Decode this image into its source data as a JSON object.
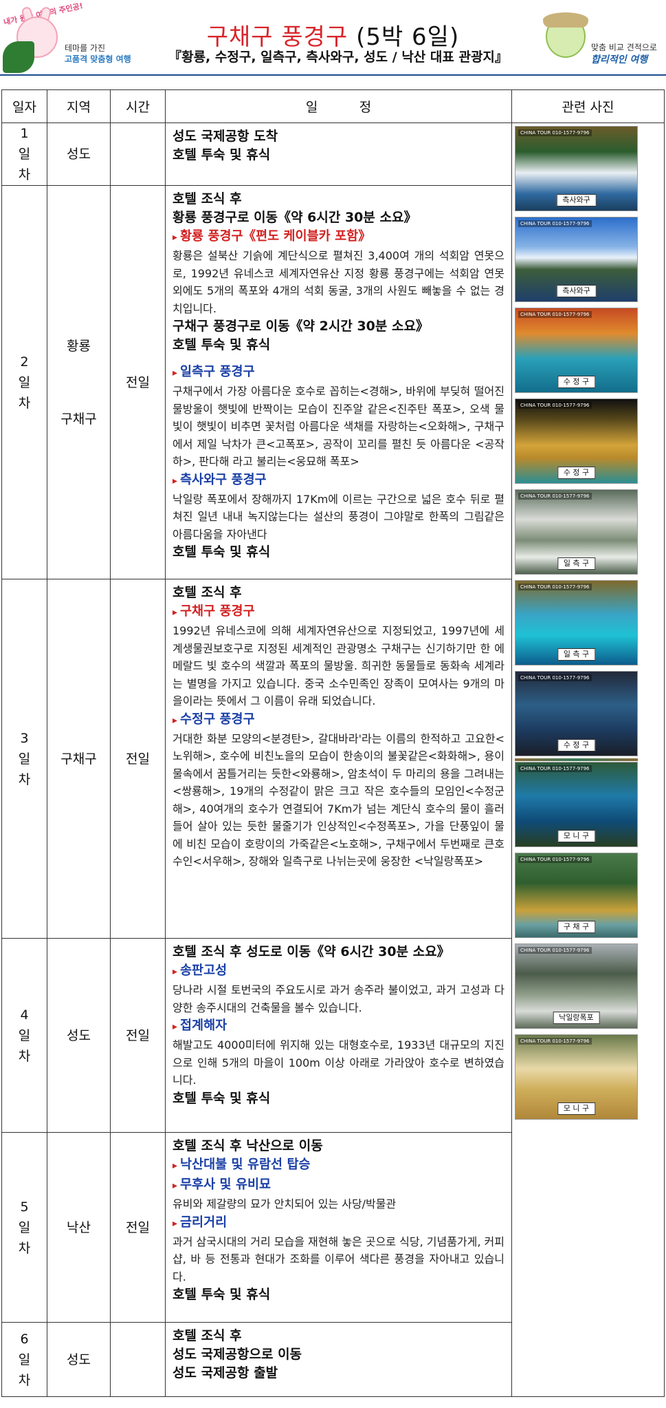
{
  "header": {
    "left_tag": "내가 원한 여행의 주인공!",
    "left_slogan_line1": "테마를 가진",
    "left_slogan_line2": "고품격 맞춤형 여행",
    "title_main": "구채구 풍경구",
    "title_days": "(5박 6일)",
    "subtitle": "『황룡, 수정구, 일측구, 측사와구, 성도 / 낙산 대표 관광지』",
    "right_text1": "맞춤 비교 견적으로",
    "right_text2": "합리적인 여행"
  },
  "table": {
    "headers": [
      "일자",
      "지역",
      "시간",
      "일          정",
      "관련 사진"
    ],
    "days": [
      {
        "day": "1\n일\n차",
        "regions": [
          "성도"
        ],
        "time": "",
        "lines": [
          {
            "type": "it",
            "text": "성도 국제공항 도착"
          },
          {
            "type": "it",
            "text": "호텔 투숙 및 휴식"
          }
        ]
      },
      {
        "day": "2\n일\n차",
        "regions": [
          "황룡",
          "구채구"
        ],
        "time": "전일",
        "lines": [
          {
            "type": "it",
            "text": "호텔 조식 후"
          },
          {
            "type": "it",
            "text": "황룡 풍경구로 이동《약 6시간 30분 소요》"
          },
          {
            "type": "sec-red",
            "text": "황룡 풍경구《편도 케이블카 포함》"
          },
          {
            "type": "desc",
            "text": "황룡은 설북산 기슭에 계단식으로 펼쳐진 3,400여 개의 석회암 연못으로, 1992년 유네스코 세계자연유산 지정 황룡 풍경구에는 석회암 연못 외에도 5개의 폭포와 4개의 석회 동굴, 3개의 사원도 빼놓을 수 없는 경치입니다."
          },
          {
            "type": "it",
            "text": "구채구 풍경구로 이동《약 2시간 30분 소요》"
          },
          {
            "type": "it",
            "text": "호텔 투숙 및 휴식"
          },
          {
            "type": "gap"
          },
          {
            "type": "sec",
            "text": "일측구 풍경구"
          },
          {
            "type": "desc",
            "text": "구채구에서 가장 아름다운 호수로 꼽히는<경해>, 바위에 부딪혀 떨어진 물방울이 햇빛에 반짝이는 모습이 진주알 같은<진주탄 폭포>, 오색 물빛이 햇빛이 비추면 꽃처럼 아름다운 색채를 자랑하는<오화해>, 구채구에서 제일 낙차가 큰<고폭포>, 공작이 꼬리를 펼친 듯 아름다운 <공작하>, 판다해 라고 불리는<웅묘해 폭포>"
          },
          {
            "type": "sec",
            "text": "측사와구 풍경구"
          },
          {
            "type": "desc",
            "text": "낙일랑 폭포에서 장해까지 17Km에 이르는 구간으로 넓은 호수 뒤로 펼쳐진 일년 내내 녹지않는다는 설산의 풍경이 그야말로 한폭의 그림같은 아름다움을 자아낸다"
          },
          {
            "type": "it",
            "text": "호텔 투숙 및 휴식"
          }
        ]
      },
      {
        "day": "3\n일\n차",
        "regions": [
          "구채구"
        ],
        "time": "전일",
        "lines": [
          {
            "type": "it",
            "text": "호텔 조식 후"
          },
          {
            "type": "sec-red",
            "text": "구채구 풍경구"
          },
          {
            "type": "desc",
            "text": "1992년 유네스코에 의해 세계자연유산으로 지정되었고, 1997년에 세계생물권보호구로 지정된 세계적인 관광명소 구채구는 신기하기만 한 에메랄드 빛 호수의 색깔과 폭포의 물방울. 희귀한 동물들로 동화속 세계라는 별명을 가지고 있습니다. 중국 소수민족인 장족이 모여사는 9개의 마을이라는 뜻에서 그 이름이 유래 되었습니다."
          },
          {
            "type": "sec",
            "text": "수정구 풍경구"
          },
          {
            "type": "desc",
            "text": "거대한 화분 모양의<분경탄>, 갈대바라'라는 이름의 한적하고 고요한<노위해>, 호수에 비친노을의 모습이 한송이의 불꽃같은<화화해>, 용이 물속에서 꿈틀거리는 듯한<와룡해>, 암초석이 두 마리의 용을 그려내는 <쌍룡해>, 19개의 수정같이 맑은 크고 작은 호수들의 모임인<수정군해>, 40여개의 호수가 연결되어 7Km가 넘는 계단식 호수의 물이 흘러들어 살아 있는 듯한 물줄기가 인상적인<수정폭포>, 가을 단풍잎이 물에 비친 모습이 호랑이의 가죽같은<노호해>, 구채구에서 두번째로 큰호수인<서우해>, 장해와 일측구로 나뉘는곳에 웅장한 <낙일랑폭포>"
          }
        ]
      },
      {
        "day": "4\n일\n차",
        "regions": [
          "성도"
        ],
        "time": "전일",
        "lines": [
          {
            "type": "it",
            "text": "호텔 조식 후 성도로 이동《약 6시간 30분 소요》"
          },
          {
            "type": "sec",
            "text": "송판고성"
          },
          {
            "type": "desc",
            "text": "당나라 시절 토번국의 주요도시로 과거 송주라 불이었고, 과거 고성과 다양한 송주시대의 건축물을 볼수 있습니다."
          },
          {
            "type": "sec",
            "text": "접계해자"
          },
          {
            "type": "desc",
            "text": "해발고도 4000미터에 위지해 있는 대형호수로, 1933년 대규모의 지진으로 인해 5개의 마을이 100m 이상 아래로 가라앉아 호수로 변하였습니다."
          },
          {
            "type": "it",
            "text": "호텔 투숙 및 휴식"
          }
        ]
      },
      {
        "day": "5\n일\n차",
        "regions": [
          "낙산"
        ],
        "time": "전일",
        "lines": [
          {
            "type": "it",
            "text": "호텔 조식 후 낙산으로 이동"
          },
          {
            "type": "sec",
            "text": "낙산대불 및 유람선 탑승"
          },
          {
            "type": "sec",
            "text": "무후사 및 유비묘"
          },
          {
            "type": "desc",
            "text": "유비와 제갈량의 묘가 안치되어 있는 사당/박물관"
          },
          {
            "type": "sec",
            "text": "금리거리"
          },
          {
            "type": "desc",
            "text": "과거 삼국시대의 거리 모습을 재현해 놓은 곳으로 식당, 기념품가게, 커피샵, 바 등 전통과 현대가 조화를 이루어 색다른 풍경을 자아내고 있습니다."
          },
          {
            "type": "it",
            "text": "호텔 투숙 및 휴식"
          }
        ]
      },
      {
        "day": "6\n일\n차",
        "regions": [
          "성도"
        ],
        "time": "",
        "lines": [
          {
            "type": "it",
            "text": "호텔 조식 후"
          },
          {
            "type": "it",
            "text": "성도 국제공항으로 이동"
          },
          {
            "type": "it",
            "text": "성도 국제공항 출발"
          }
        ]
      }
    ]
  },
  "photos": [
    {
      "caption": "측사와구",
      "brand": "CHINA TOUR 010-1577-9796",
      "cls": "ph1"
    },
    {
      "caption": "측사와구",
      "brand": "CHINA TOUR 010-1577-9796",
      "cls": "ph2"
    },
    {
      "caption": "수 정 구",
      "brand": "CHINA TOUR 010-1577-9796",
      "cls": "ph3"
    },
    {
      "caption": "수 정 구",
      "brand": "CHINA TOUR 010-1577-9796",
      "cls": "ph4"
    },
    {
      "caption": "일 측 구",
      "brand": "CHINA TOUR 010-1577-9796",
      "cls": "ph5"
    },
    {
      "caption": "일 측 구",
      "brand": "CHINA TOUR 010-1577-9796",
      "cls": "ph6"
    },
    {
      "caption": "수 정 구",
      "brand": "CHINA TOUR 010-1577-9796",
      "cls": "ph7"
    },
    {
      "caption": "모 니 구",
      "brand": "CHINA TOUR 010-1577-9796",
      "cls": "ph8"
    },
    {
      "caption": "구 채 구",
      "brand": "CHINA TOUR 010-1577-9796",
      "cls": "ph9"
    },
    {
      "caption": "낙일랑폭포",
      "brand": "CHINA TOUR 010-1577-9796",
      "cls": "ph10"
    },
    {
      "caption": "모 니 구",
      "brand": "CHINA TOUR 010-1577-9796",
      "cls": "ph11"
    }
  ]
}
